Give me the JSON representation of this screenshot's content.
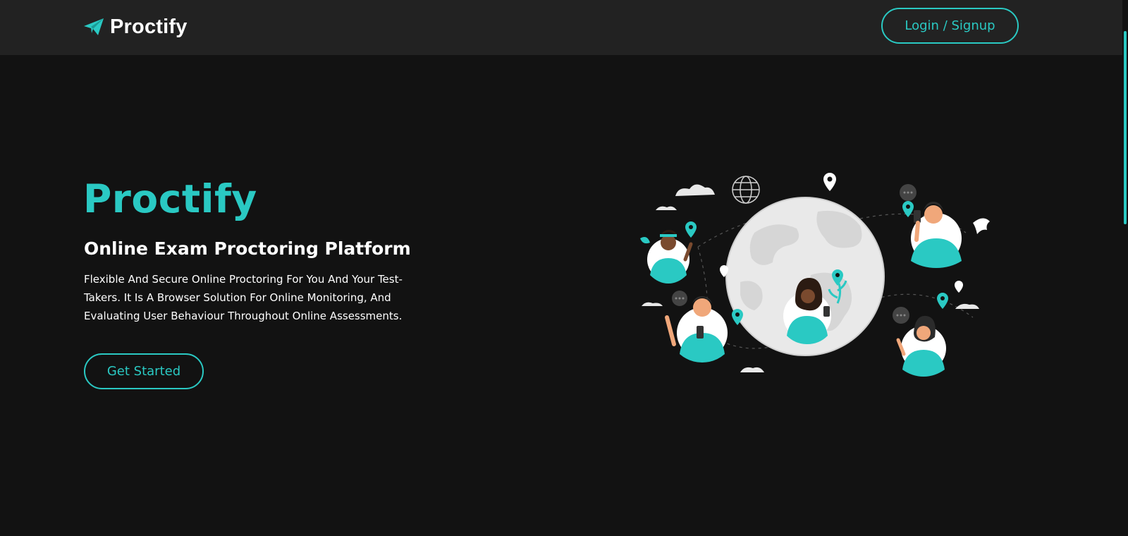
{
  "nav": {
    "brand": "Proctify",
    "brand_icon": "paper-plane-icon",
    "login_label": "Login / Signup"
  },
  "hero": {
    "title": "Proctify",
    "subtitle": "Online Exam Proctoring Platform",
    "description": "Flexible And Secure Online Proctoring For You And Your Test-Takers. It Is A Browser Solution For Online Monitoring, And Evaluating User Behaviour Throughout Online Assessments.",
    "cta_label": "Get Started"
  },
  "illustration": {
    "name": "globe-people-illustration"
  },
  "colors": {
    "accent": "#2ac9c3",
    "background": "#121212",
    "navbar": "#222222",
    "text": "#ffffff"
  }
}
